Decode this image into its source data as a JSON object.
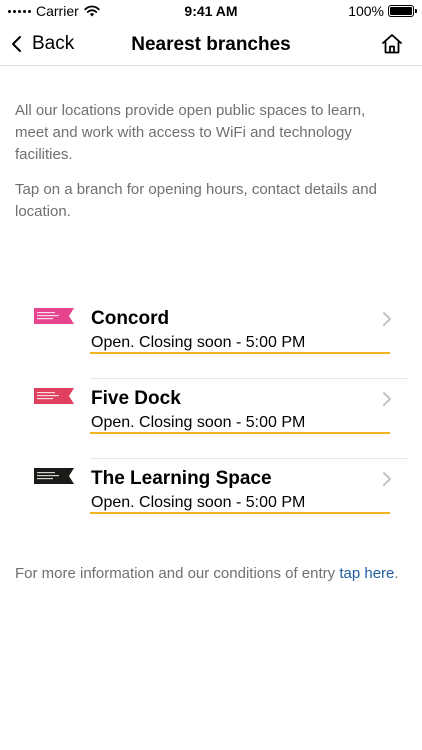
{
  "status_bar": {
    "carrier": "Carrier",
    "time": "9:41 AM",
    "battery": "100%",
    "battery_level": 1.0,
    "icons": [
      "signal-dots-icon",
      "wifi-icon",
      "battery-icon"
    ]
  },
  "nav": {
    "back_label": "Back",
    "title": "Nearest branches",
    "icons": [
      "chevron-left-icon",
      "home-icon"
    ]
  },
  "intro": {
    "paragraph1": "All our locations provide open public spaces to learn, meet and work with access to WiFi and technology facilities.",
    "paragraph2": "Tap on a branch for opening hours, contact details and location."
  },
  "branches": [
    {
      "name": "Concord",
      "status": "Open. Closing soon - 5:00 PM",
      "logo_color": "#e6458d"
    },
    {
      "name": "Five Dock",
      "status": "Open. Closing soon - 5:00 PM",
      "logo_color": "#e0405e"
    },
    {
      "name": "The Learning Space",
      "status": "Open. Closing soon - 5:00 PM",
      "logo_color": "#1c1a17"
    }
  ],
  "footer": {
    "text": "For more information and our conditions of entry ",
    "link_text": "tap here",
    "end": "."
  },
  "colors": {
    "accent_underline": "#f0b41e",
    "link": "#1f5fa0",
    "muted_text": "#707070"
  }
}
